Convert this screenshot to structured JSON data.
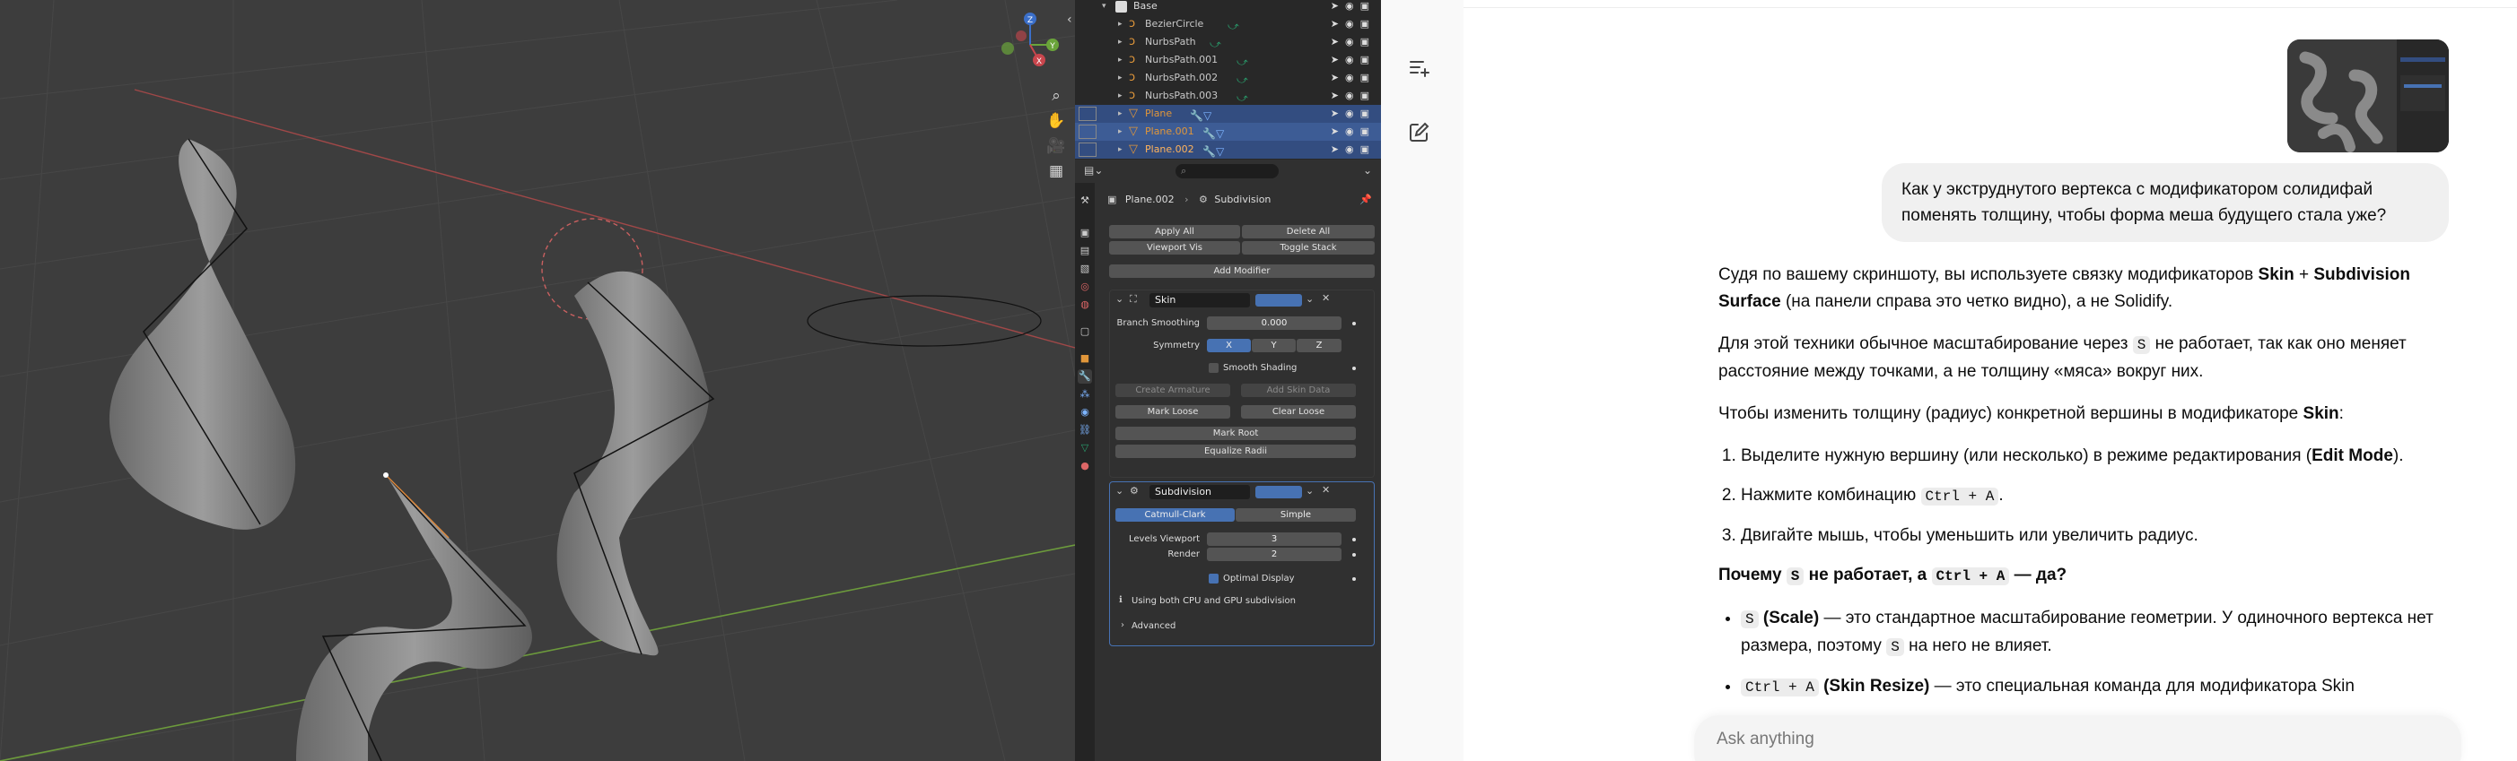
{
  "viewport": {
    "tools": [
      "zoom-icon",
      "hand-icon",
      "camera-icon",
      "grid-icon"
    ],
    "gizmo_axes": {
      "z": "Z",
      "y": "Y",
      "x": "X"
    }
  },
  "outliner": {
    "rows": [
      {
        "name": "Base",
        "type": "collection",
        "selected": false
      },
      {
        "name": "BezierCircle",
        "type": "curve",
        "selected": false
      },
      {
        "name": "NurbsPath",
        "type": "curve",
        "selected": false
      },
      {
        "name": "NurbsPath.001",
        "type": "curve",
        "selected": false
      },
      {
        "name": "NurbsPath.002",
        "type": "curve",
        "selected": false
      },
      {
        "name": "NurbsPath.003",
        "type": "curve",
        "selected": false
      },
      {
        "name": "Plane",
        "type": "mesh",
        "selected": true
      },
      {
        "name": "Plane.001",
        "type": "mesh",
        "selected": true
      },
      {
        "name": "Plane.002",
        "type": "mesh",
        "selected": true
      }
    ]
  },
  "properties": {
    "breadcrumb_object": "Plane.002",
    "breadcrumb_modifier": "Subdivision",
    "apply_all": "Apply All",
    "delete_all": "Delete All",
    "viewport_vis": "Viewport Vis",
    "toggle_stack": "Toggle Stack",
    "add_modifier": "Add Modifier",
    "skin": {
      "name": "Skin",
      "branch_smoothing_label": "Branch Smoothing",
      "branch_smoothing_value": "0.000",
      "symmetry_label": "Symmetry",
      "symmetry_x": "X",
      "symmetry_y": "Y",
      "symmetry_z": "Z",
      "smooth_shading": "Smooth Shading",
      "create_armature": "Create Armature",
      "add_skin_data": "Add Skin Data",
      "mark_loose": "Mark Loose",
      "clear_loose": "Clear Loose",
      "mark_root": "Mark Root",
      "equalize_radii": "Equalize Radii"
    },
    "subdivision": {
      "name": "Subdivision",
      "catmull_clark": "Catmull-Clark",
      "simple": "Simple",
      "levels_viewport_label": "Levels Viewport",
      "levels_viewport_value": "3",
      "render_label": "Render",
      "render_value": "2",
      "optimal_display": "Optimal Display",
      "info": "Using both CPU and GPU subdivision",
      "advanced": "Advanced"
    }
  },
  "chat": {
    "user_message": "Как у экструднутого вертекса с модификатором солидифай поменять толщину, чтобы форма меша будущего стала уже?",
    "p1_a": "Судя по вашему скриншоту, вы используете связку модификаторов ",
    "p1_b": "Skin",
    "p1_c": " + ",
    "p1_d": "Subdivision Surface",
    "p1_e": " (на панели справа это четко видно), а не Solidify.",
    "p2_a": "Для этой техники обычное масштабирование через ",
    "p2_code": "S",
    "p2_b": " не работает, так как оно меняет расстояние между точками, а не толщину «мяса» вокруг них.",
    "p3_a": "Чтобы изменить толщину (радиус) конкретной вершины в модификаторе ",
    "p3_b": "Skin",
    "p3_c": ":",
    "step1_a": "Выделите нужную вершину (или несколько) в режиме редактирования (",
    "step1_b": "Edit Mode",
    "step1_c": ").",
    "step2_a": "Нажмите комбинацию ",
    "step2_code": "Ctrl + A",
    "step2_b": ".",
    "step3": "Двигайте мышь, чтобы уменьшить или увеличить радиус.",
    "h_a": "Почему ",
    "h_code1": "S",
    "h_b": " не работает, а ",
    "h_code2": "Ctrl + A",
    "h_c": " — да?",
    "b1_code": "S",
    "b1_a": " (Scale)",
    "b1_b": " — это стандартное масштабирование геометрии. У одиночного вертекса нет размера, поэтому ",
    "b1_code2": "S",
    "b1_c": " на него не влияет.",
    "b2_code": "Ctrl + A",
    "b2_a": " (Skin Resize)",
    "b2_b": " — это специальная команда для модификатора Skin",
    "composer_placeholder": "Ask anything"
  }
}
